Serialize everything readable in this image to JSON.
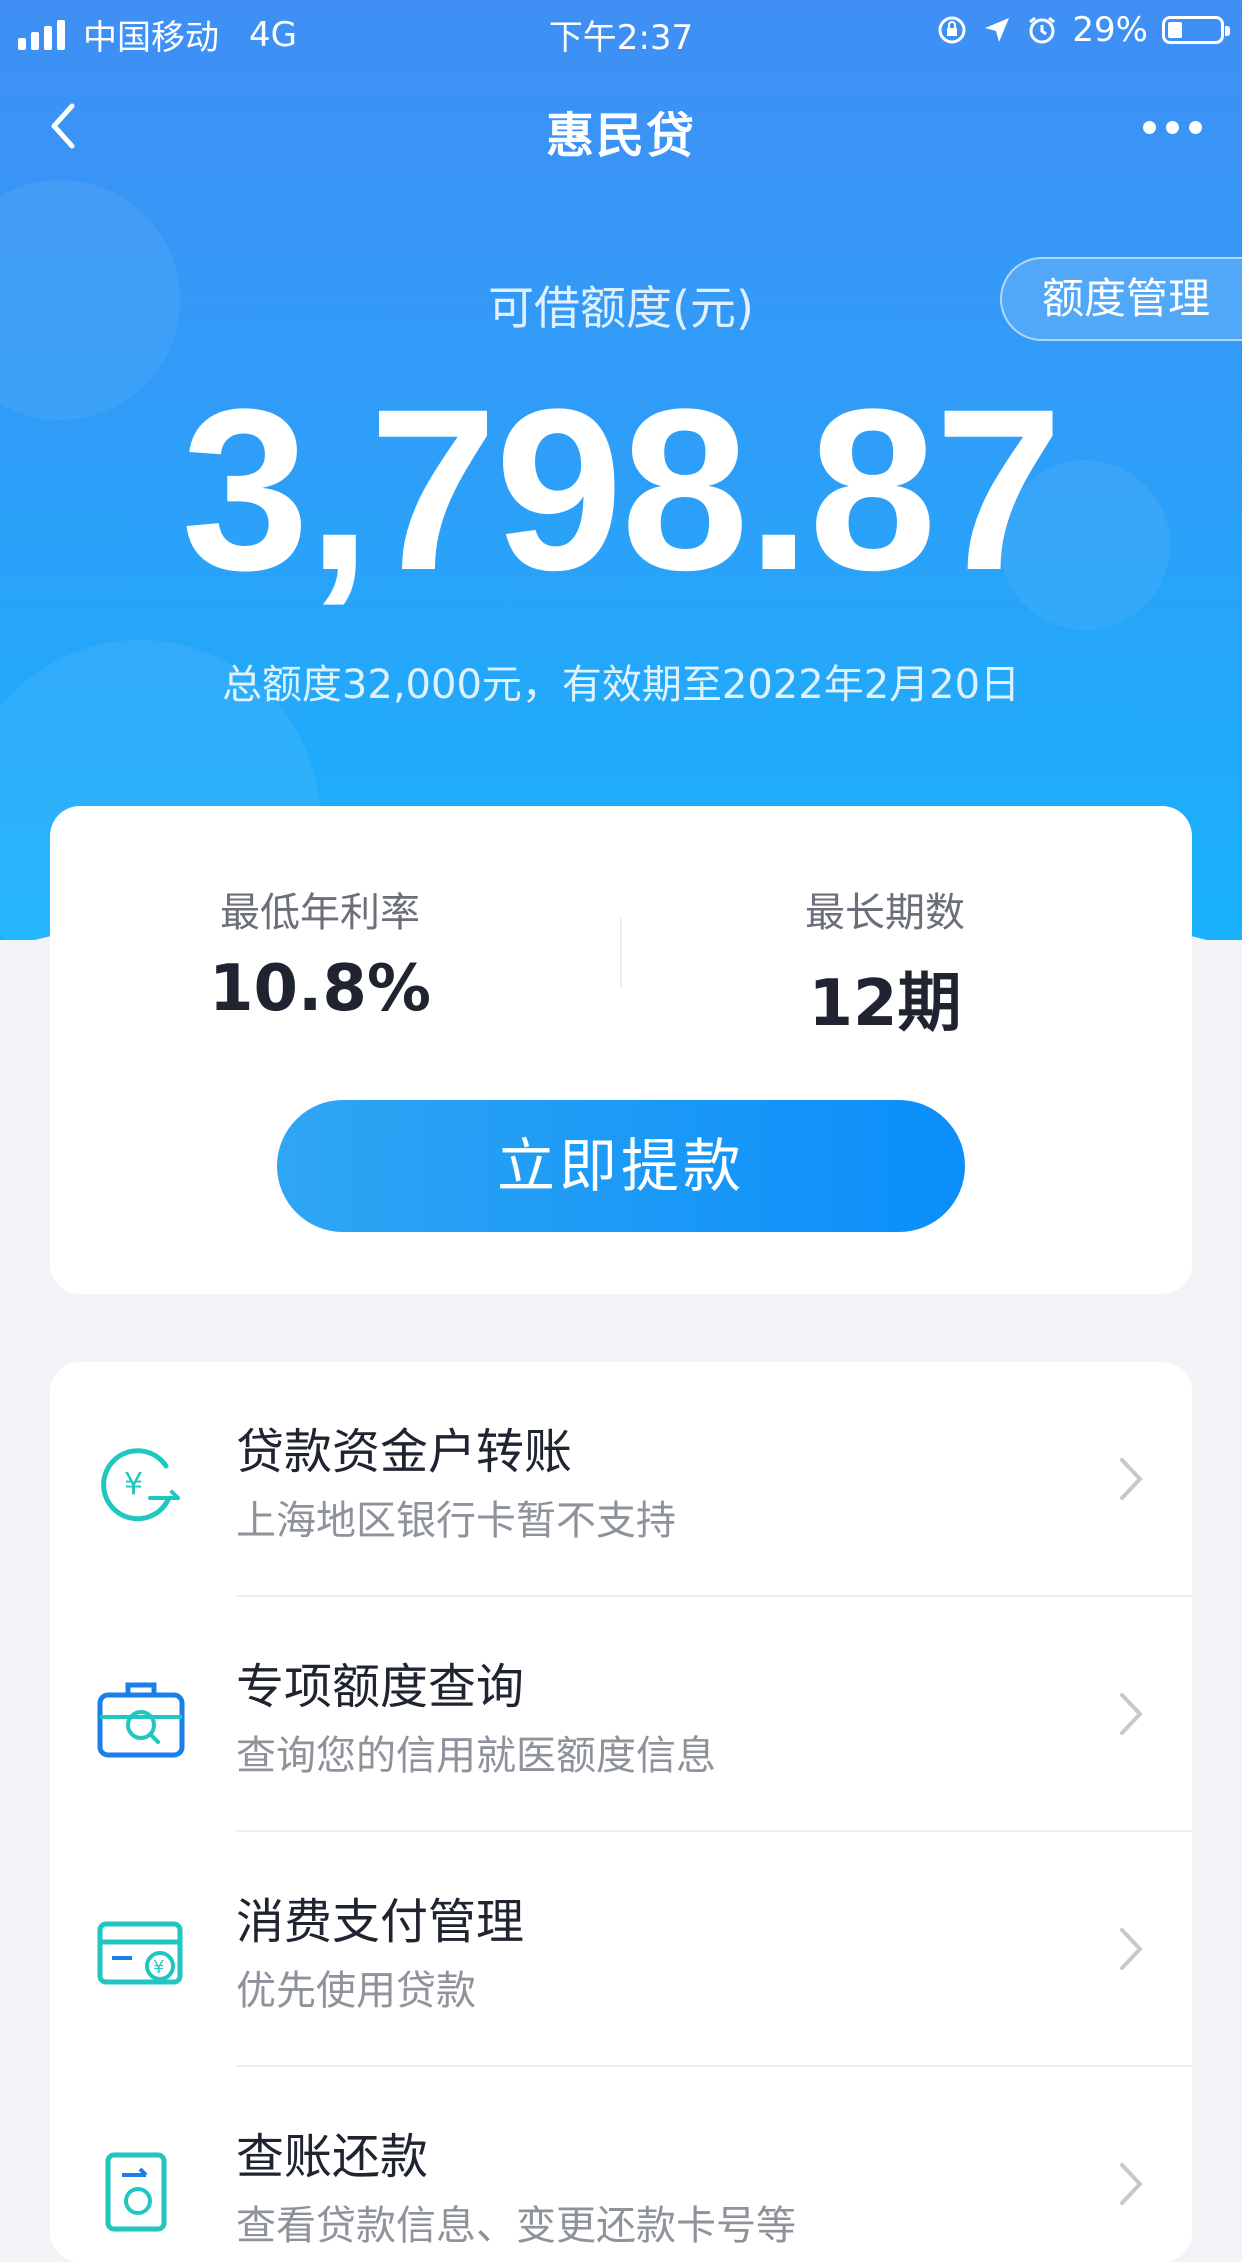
{
  "status_bar": {
    "carrier": "中国移动",
    "network": "4G",
    "time": "下午2:37",
    "battery_percent": "29%",
    "battery_level": 0.29
  },
  "nav": {
    "title": "惠民贷"
  },
  "limit": {
    "label": "可借额度(元)",
    "manage_label": "额度管理",
    "amount": "3,798.87",
    "total_line": "总额度32,000元，有效期至2022年2月20日"
  },
  "stats": {
    "rate_label": "最低年利率",
    "rate_value": "10.8%",
    "term_label": "最长期数",
    "term_value": "12期"
  },
  "withdraw_label": "立即提款",
  "menu": [
    {
      "icon": "yuan-transfer-icon",
      "title": "贷款资金户转账",
      "subtitle": "上海地区银行卡暂不支持"
    },
    {
      "icon": "medical-kit-search-icon",
      "title": "专项额度查询",
      "subtitle": "查询您的信用就医额度信息"
    },
    {
      "icon": "card-payment-icon",
      "title": "消费支付管理",
      "subtitle": "优先使用贷款"
    },
    {
      "icon": "bill-repay-icon",
      "title": "查账还款",
      "subtitle": "查看贷款信息、变更还款卡号等"
    }
  ],
  "colors": {
    "primary_blue": "#2f9df8",
    "teal_icon": "#1fc7c0",
    "icon_blue": "#1a7fe8"
  }
}
